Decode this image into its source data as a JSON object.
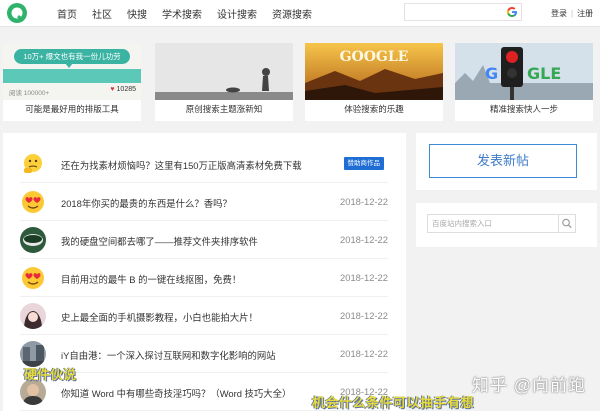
{
  "nav": {
    "items": [
      "首页",
      "社区",
      "快搜",
      "学术搜索",
      "设计搜索",
      "资源搜索"
    ]
  },
  "auth": {
    "login": "登录",
    "separator": "|",
    "register": "注册"
  },
  "cards": [
    {
      "caption": "可能是最好用的排版工具",
      "bubble": "10万+ 爆文也有我一份儿功劳",
      "read_label": "阅读 100000+",
      "likes": "10285"
    },
    {
      "caption": "原创搜索主题涨新知"
    },
    {
      "caption": "体验搜索的乐趣",
      "logo_text": "GOOGLE"
    },
    {
      "caption": "精准搜索快人一步"
    }
  ],
  "posts": [
    {
      "title": "还在为找素材烦恼吗？这里有150万正版高清素材免费下载",
      "tag": "赞助商作品",
      "avatar": "thinking-emoji-icon"
    },
    {
      "title": "2018年你买的最贵的东西是什么？香吗？",
      "date": "2018-12-22",
      "avatar": "heart-eyes-emoji-icon"
    },
    {
      "title": "我的硬盘空间都去哪了——推荐文件夹排序软件",
      "date": "2018-12-22",
      "avatar": "disk-avatar-icon"
    },
    {
      "title": "目前用过的最牛 B 的一键在线抠图，免费！",
      "date": "2018-12-22",
      "avatar": "heart-eyes-emoji-icon"
    },
    {
      "title": "史上最全面的手机摄影教程，小白也能拍大片！",
      "date": "2018-12-22",
      "avatar": "girl-avatar-icon"
    },
    {
      "title": "iY自由港：一个深入探讨互联网和数字化影响的网站",
      "date": "2018-12-22",
      "avatar": "street-avatar-icon"
    },
    {
      "title": "你知道 Word 中有哪些奇技淫巧吗？（Word 技巧大全）",
      "date": "2018-12-22",
      "avatar": "man-avatar-icon"
    }
  ],
  "sidebar": {
    "post_button": "发表新帖",
    "search_placeholder": "百度站内搜索入口"
  },
  "watermarks": {
    "zhihu": "知乎 @向前跑",
    "overlay_title": "硬件伙说",
    "overlay_sub": "机会什么条件可以抽手有想"
  },
  "colors": {
    "brand_green": "#2fb36b",
    "accent_blue": "#3d7bc6",
    "tag_blue": "#1f6ed4"
  }
}
